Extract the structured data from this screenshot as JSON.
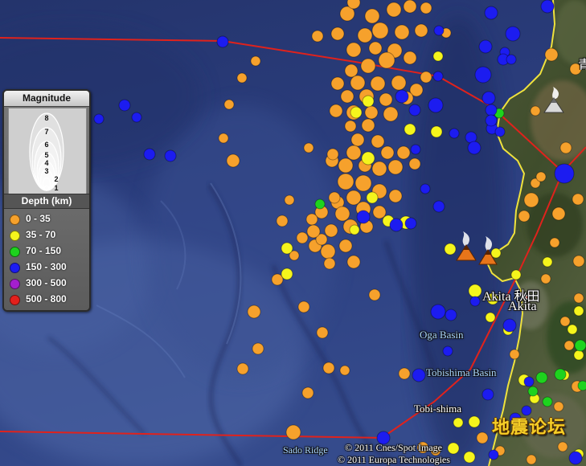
{
  "map": {
    "colors": {
      "ocean": "#2a3b78",
      "land": "#46532f",
      "coastline": "#efe23d",
      "boundary": "#e0221c"
    }
  },
  "legend": {
    "magnitude_title": "Magnitude",
    "magnitude_scale": [
      "8",
      "7",
      "6",
      "5",
      "4",
      "3",
      "2",
      "1"
    ],
    "depth_title": "Depth (km)",
    "depth_classes": [
      {
        "label": "0 - 35",
        "color": "#f6a12c"
      },
      {
        "label": "35 - 70",
        "color": "#f5f51c"
      },
      {
        "label": "70 - 150",
        "color": "#1ed31e"
      },
      {
        "label": "150 - 300",
        "color": "#1c1cf0"
      },
      {
        "label": "300 - 500",
        "color": "#a41fcf"
      },
      {
        "label": "500 - 800",
        "color": "#e3201c"
      }
    ]
  },
  "place_labels": {
    "akita_region": "Akita 秋田",
    "akita_city": "Akita",
    "oga_basin": "Oga Basin",
    "tobishima_basin": "Tobishima Basin",
    "tobi_shima": "Tobi-shima",
    "sado_ridge": "Sado Ridge",
    "edge_label": "青"
  },
  "attribution": {
    "line1": "© 2011 Cnes/Spot Image",
    "line2": "© 2011 Europa Technologies"
  },
  "watermark": {
    "text": "地震论坛"
  },
  "icons": {
    "volcano": "volcano-icon",
    "city": "city-marker-icon",
    "earthquake": "earthquake-marker"
  }
}
